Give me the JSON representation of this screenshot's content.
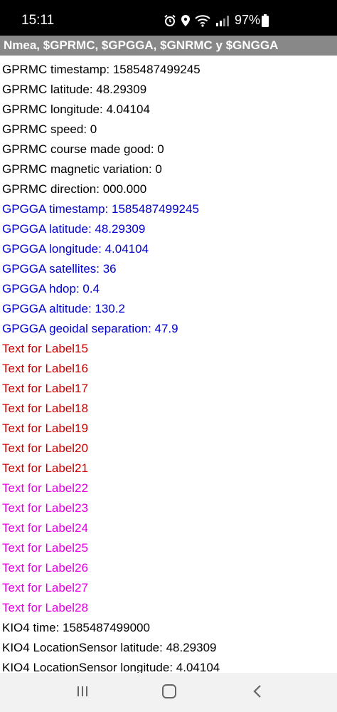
{
  "status_bar": {
    "time": "15:11",
    "battery_percent": "97%",
    "icons": [
      "alarm-icon",
      "location-icon",
      "wifi-icon",
      "signal-icon",
      "battery-icon"
    ]
  },
  "title_bar": {
    "title": "Nmea, $GPRMC, $GPGGA, $GNRMC y $GNGGA"
  },
  "labels": [
    {
      "text": "GPRMC timestamp: 1585487499245",
      "color": "#000000"
    },
    {
      "text": "GPRMC latitude: 48.29309",
      "color": "#000000"
    },
    {
      "text": "GPRMC longitude: 4.04104",
      "color": "#000000"
    },
    {
      "text": "GPRMC speed: 0",
      "color": "#000000"
    },
    {
      "text": "GPRMC course made good: 0",
      "color": "#000000"
    },
    {
      "text": "GPRMC magnetic variation: 0",
      "color": "#000000"
    },
    {
      "text": "GPRMC direction: 000.000",
      "color": "#000000"
    },
    {
      "text": "GPGGA timestamp: 1585487499245",
      "color": "#0000cc"
    },
    {
      "text": "GPGGA latitude: 48.29309",
      "color": "#0000cc"
    },
    {
      "text": "GPGGA longitude: 4.04104",
      "color": "#0000cc"
    },
    {
      "text": "GPGGA satellites: 36",
      "color": "#0000cc"
    },
    {
      "text": "GPGGA hdop: 0.4",
      "color": "#0000cc"
    },
    {
      "text": "GPGGA altitude: 130.2",
      "color": "#0000cc"
    },
    {
      "text": "GPGGA geoidal separation: 47.9",
      "color": "#0000cc"
    },
    {
      "text": "Text for Label15",
      "color": "#cc0000"
    },
    {
      "text": "Text for Label16",
      "color": "#cc0000"
    },
    {
      "text": "Text for Label17",
      "color": "#cc0000"
    },
    {
      "text": "Text for Label18",
      "color": "#cc0000"
    },
    {
      "text": "Text for Label19",
      "color": "#cc0000"
    },
    {
      "text": "Text for Label20",
      "color": "#cc0000"
    },
    {
      "text": "Text for Label21",
      "color": "#cc0000"
    },
    {
      "text": "Text for Label22",
      "color": "#e600e6"
    },
    {
      "text": "Text for Label23",
      "color": "#e600e6"
    },
    {
      "text": "Text for Label24",
      "color": "#e600e6"
    },
    {
      "text": "Text for Label25",
      "color": "#e600e6"
    },
    {
      "text": "Text for Label26",
      "color": "#e600e6"
    },
    {
      "text": "Text for Label27",
      "color": "#e600e6"
    },
    {
      "text": "Text for Label28",
      "color": "#e600e6"
    },
    {
      "text": "KIO4 time: 1585487499000",
      "color": "#000000"
    },
    {
      "text": "KIO4 LocationSensor latitude: 48.29309",
      "color": "#000000"
    },
    {
      "text": "KIO4 LocationSensor longitude: 4.04104",
      "color": "#000000"
    }
  ],
  "nav_bar": {
    "icons": [
      "recent-apps-icon",
      "home-icon",
      "back-icon"
    ]
  }
}
